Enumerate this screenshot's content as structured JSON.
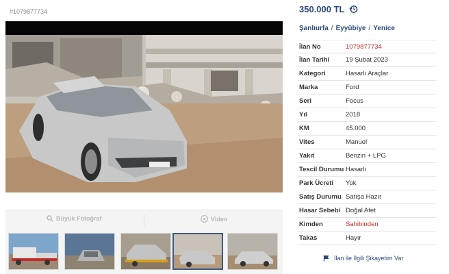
{
  "listing_id_top": "#1079877734",
  "price": "350.000 TL",
  "breadcrumb": [
    "Şanlıurfa",
    "Eyyübiye",
    "Yenice"
  ],
  "details": [
    {
      "key": "İlan No",
      "value": "1079877734",
      "highlight": true
    },
    {
      "key": "İlan Tarihi",
      "value": "19 Şubat 2023",
      "highlight": false
    },
    {
      "key": "Kategori",
      "value": "Hasarlı Araçlar",
      "highlight": false
    },
    {
      "key": "Marka",
      "value": "Ford",
      "highlight": false
    },
    {
      "key": "Seri",
      "value": "Focus",
      "highlight": false
    },
    {
      "key": "Yıl",
      "value": "2018",
      "highlight": false
    },
    {
      "key": "KM",
      "value": "45.000",
      "highlight": false
    },
    {
      "key": "Vites",
      "value": "Manuel",
      "highlight": false
    },
    {
      "key": "Yakıt",
      "value": "Benzin + LPG",
      "highlight": false
    },
    {
      "key": "Tescil Durumu",
      "value": "Hasarlı",
      "highlight": false
    },
    {
      "key": "Park Ücreti",
      "value": "Yok",
      "highlight": false
    },
    {
      "key": "Satış Durumu",
      "value": "Satışa Hazır",
      "highlight": false
    },
    {
      "key": "Hasar Sebebi",
      "value": "Doğal Afet",
      "highlight": false
    },
    {
      "key": "Kimden",
      "value": "Sahibinden",
      "highlight": true
    },
    {
      "key": "Takas",
      "value": "Hayır",
      "highlight": false
    }
  ],
  "media_tabs": {
    "photo": "Büyük Fotoğraf",
    "video": "Video"
  },
  "report_link": "İlan ile İlgili Şikayetim Var",
  "thumbnails": [
    "tow-truck",
    "car-front",
    "car-on-truck",
    "car-rubble-selected",
    "car-side"
  ],
  "colors": {
    "accent": "#2b4a7a",
    "highlight": "#c4302b"
  }
}
